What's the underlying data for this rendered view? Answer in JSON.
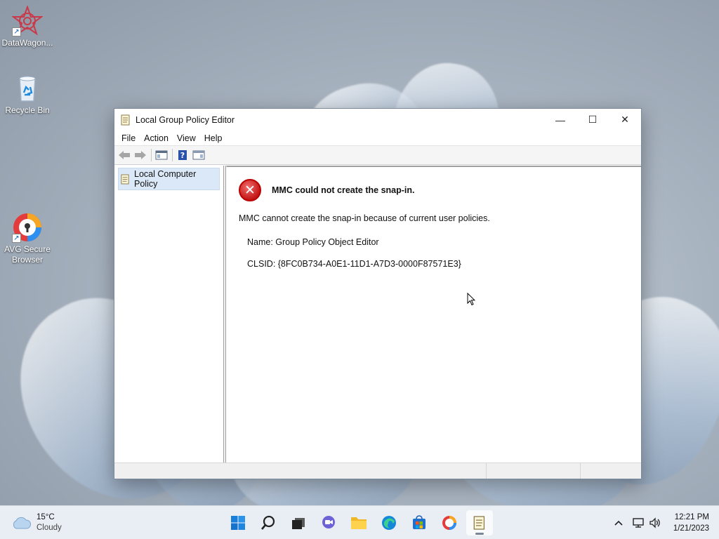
{
  "desktop": {
    "icons": [
      {
        "label": "DataWagon...",
        "icon": "datawagon-icon"
      },
      {
        "label": "Recycle Bin",
        "icon": "recycle-bin-icon"
      },
      {
        "label": "AVG Secure Browser",
        "icon": "avg-browser-icon"
      }
    ]
  },
  "window": {
    "title": "Local Group Policy Editor",
    "controls": {
      "minimize": "—",
      "maximize": "☐",
      "close": "✕"
    },
    "menu": [
      "File",
      "Action",
      "View",
      "Help"
    ],
    "toolbar": [
      "back-arrow-icon",
      "forward-arrow-icon",
      "show-hide-console-tree-icon",
      "help-icon",
      "show-hide-action-pane-icon"
    ],
    "tree": {
      "selected_item": "Local Computer Policy"
    },
    "error": {
      "title": "MMC could not create the snap-in.",
      "message": "MMC cannot create the snap-in because of current user policies.",
      "name_line": "Name: Group Policy Object Editor",
      "clsid_line": "CLSID: {8FC0B734-A0E1-11D1-A7D3-0000F87571E3}"
    }
  },
  "taskbar": {
    "weather": {
      "temp": "15°C",
      "condition": "Cloudy"
    },
    "apps": [
      "start",
      "search",
      "task-view",
      "chat",
      "file-explorer",
      "edge",
      "store",
      "avg-browser",
      "group-policy-editor"
    ],
    "clock": {
      "time": "12:21 PM",
      "date": "1/21/2023"
    },
    "colors": {
      "accent": "#0067c0",
      "error_red": "#c41717"
    }
  }
}
